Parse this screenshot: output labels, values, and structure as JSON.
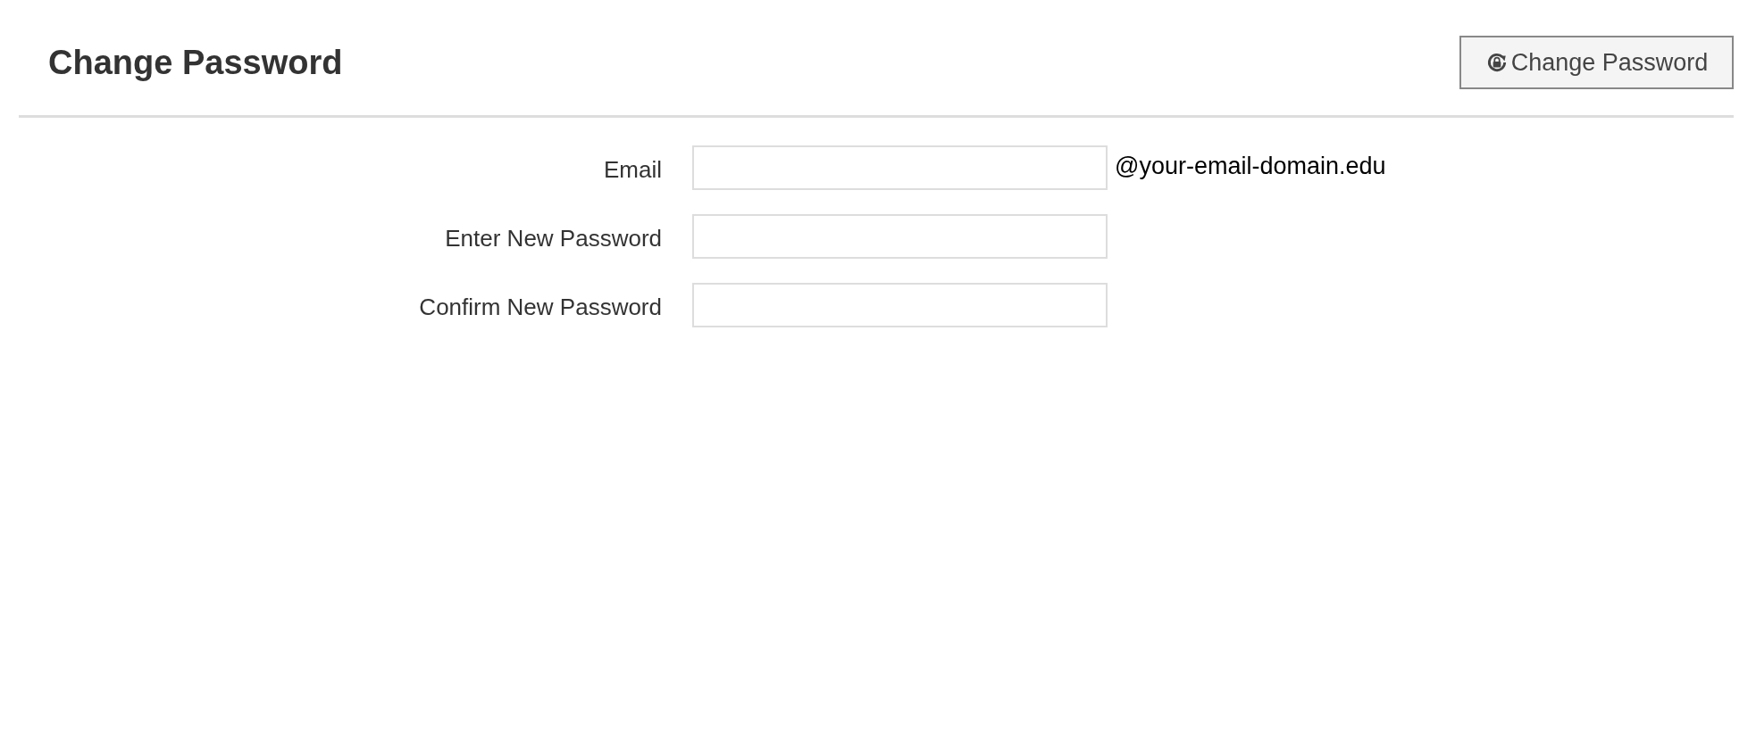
{
  "header": {
    "title": "Change Password",
    "button": "Change Password"
  },
  "fields": [
    {
      "label": "Email",
      "suffix": "@your-email-domain.edu"
    },
    {
      "label": "Enter New Password"
    },
    {
      "label": "Confirm New Password"
    }
  ]
}
